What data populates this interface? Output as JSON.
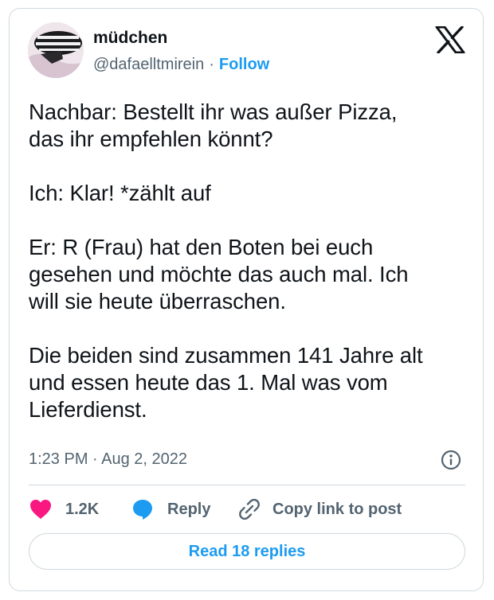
{
  "author": {
    "display_name": "müdchen",
    "handle": "@dafaelltmirein",
    "separator": "·",
    "follow_label": "Follow"
  },
  "tweet": {
    "text": "Nachbar: Bestellt ihr was außer Pizza,\ndas ihr empfehlen könnt?\n\nIch: Klar! *zählt auf\n\nEr: R (Frau) hat den Boten bei euch\ngesehen und möchte das auch mal. Ich\nwill sie heute überraschen.\n\nDie beiden sind zusammen 141 Jahre alt\nund essen heute das 1. Mal was vom\nLieferdienst.",
    "timestamp": "1:23 PM · Aug 2, 2022"
  },
  "actions": {
    "likes_count": "1.2K",
    "reply_label": "Reply",
    "copy_link_label": "Copy link to post"
  },
  "read_replies_label": "Read 18 replies",
  "icons": {
    "brand": "x-logo-icon",
    "info": "info-icon",
    "like": "heart-icon",
    "reply": "speech-bubble-icon",
    "copy": "link-icon"
  },
  "colors": {
    "accent": "#1d9bf0",
    "like": "#f91880",
    "muted": "#536471",
    "border": "#cfd9de",
    "text": "#0f1419"
  }
}
